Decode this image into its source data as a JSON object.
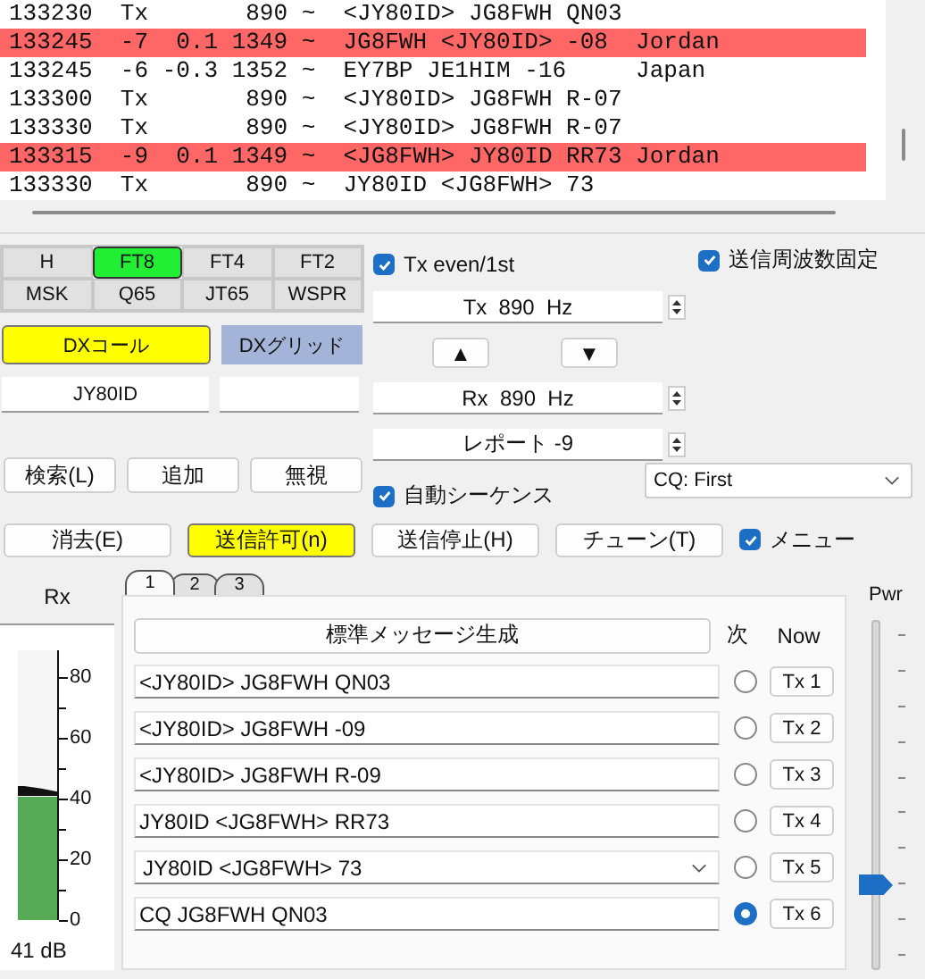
{
  "decodes": [
    {
      "text": "133230  Tx       890 ~  <JY80ID> JG8FWH QN03",
      "highlighted": false
    },
    {
      "text": "133245  -7  0.1 1349 ~  JG8FWH <JY80ID> -08  Jordan",
      "highlighted": true
    },
    {
      "text": "133245  -6 -0.3 1352 ~  EY7BP JE1HIM -16     Japan",
      "highlighted": false
    },
    {
      "text": "133300  Tx       890 ~  <JY80ID> JG8FWH R-07",
      "highlighted": false
    },
    {
      "text": "133330  Tx       890 ~  <JY80ID> JG8FWH R-07",
      "highlighted": false
    },
    {
      "text": "133315  -9  0.1 1349 ~  <JG8FWH> JY80ID RR73 Jordan",
      "highlighted": true
    },
    {
      "text": "133330  Tx       890 ~  JY80ID <JG8FWH> 73",
      "highlighted": false
    }
  ],
  "modes": [
    {
      "label": "H",
      "selected": false
    },
    {
      "label": "FT8",
      "selected": true
    },
    {
      "label": "FT4",
      "selected": false
    },
    {
      "label": "FT2",
      "selected": false
    },
    {
      "label": "MSK",
      "selected": false
    },
    {
      "label": "Q65",
      "selected": false
    },
    {
      "label": "JT65",
      "selected": false
    },
    {
      "label": "WSPR",
      "selected": false
    }
  ],
  "tx_even": {
    "label": "Tx even/1st",
    "checked": true
  },
  "hold_tx_freq": {
    "label": "送信周波数固定",
    "checked": true
  },
  "tx_freq": "Tx  890  Hz",
  "freq_buttons": [
    "▲",
    "▼"
  ],
  "rx_freq": "Rx  890  Hz",
  "report": "レポート -9",
  "dx_call_button": "DXコール",
  "dx_grid_button": "DXグリッド",
  "dx_call": "JY80ID",
  "lookup_buttons": [
    "検索(L)",
    "追加",
    "無視"
  ],
  "auto_seq": {
    "label": "自動シーケンス",
    "checked": true
  },
  "cq_mode": "CQ: First",
  "action_buttons": [
    {
      "label": "消去(E)",
      "active": false
    },
    {
      "label": "送信許可(n)",
      "active": true
    },
    {
      "label": "送信停止(H)",
      "active": false
    },
    {
      "label": "チューン(T)",
      "active": false
    }
  ],
  "menu_toggle": {
    "label": "メニュー",
    "checked": true
  },
  "rx_meter": {
    "label": "Rx",
    "ticks": [
      "80",
      "60",
      "40",
      "20",
      "0"
    ],
    "level": 0.46,
    "reading": "41 dB"
  },
  "message_tabs": [
    {
      "label": "1",
      "selected": true
    },
    {
      "label": "2",
      "selected": false
    },
    {
      "label": "3",
      "selected": false
    }
  ],
  "generate_button": "標準メッセージ生成",
  "next_header": "次",
  "now_header": "Now",
  "messages": [
    {
      "kind": "field",
      "text": "<JY80ID> JG8FWH QN03",
      "selected": false,
      "button": "Tx 1"
    },
    {
      "kind": "field",
      "text": "<JY80ID> JG8FWH -09",
      "selected": false,
      "button": "Tx 2"
    },
    {
      "kind": "field",
      "text": "<JY80ID> JG8FWH R-09",
      "selected": false,
      "button": "Tx 3"
    },
    {
      "kind": "field",
      "text": "JY80ID <JG8FWH> RR73",
      "selected": false,
      "button": "Tx 4"
    },
    {
      "kind": "dropdown",
      "text": "JY80ID <JG8FWH> 73",
      "selected": false,
      "button": "Tx 5"
    },
    {
      "kind": "field",
      "text": "CQ JG8FWH QN03",
      "selected": true,
      "button": "Tx 6"
    }
  ],
  "power": {
    "label": "Pwr",
    "level": 0.24
  }
}
